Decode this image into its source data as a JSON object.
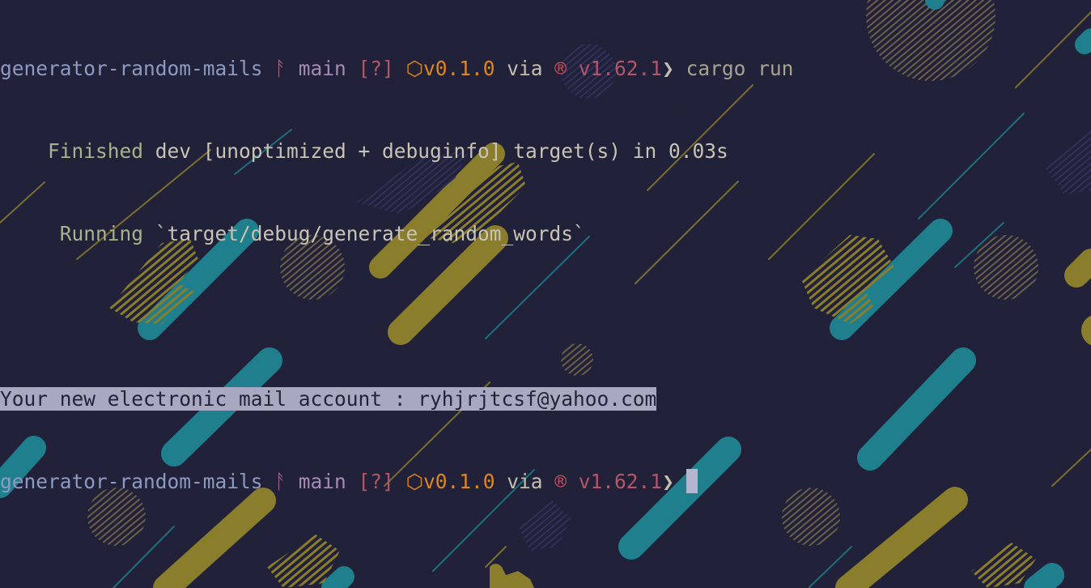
{
  "terminal": {
    "prompt": {
      "directory": "generator-random-mails",
      "separator_icon": "git-branch-icon",
      "separator_glyph": "ᚨ",
      "branch": "main",
      "status": "[?]",
      "package_icon": "package-icon",
      "package_glyph": "⬡",
      "package_version": "v0.1.0",
      "via": "via",
      "rust_icon": "rust-icon",
      "rust_glyph": "®",
      "rust_version": "v1.62.1",
      "arrow_icon": "prompt-arrow-icon",
      "arrow_glyph": "❯"
    },
    "command": "cargo run",
    "finished": {
      "label": "Finished",
      "text": "dev [unoptimized + debuginfo] target(s) in 0.03s"
    },
    "running": {
      "label": "Running",
      "text": "`target/debug/generate_random_words`"
    },
    "output": "Your new electronic mail account : ryhjrjtcsf@yahoo.com",
    "colors": {
      "background": "#21213a",
      "teal_accent": "#1f7f8c",
      "olive_accent": "#8a7d2c",
      "package_orange": "#e0861e",
      "rust_red": "#b25768",
      "selection": "#a8a9c0"
    }
  }
}
